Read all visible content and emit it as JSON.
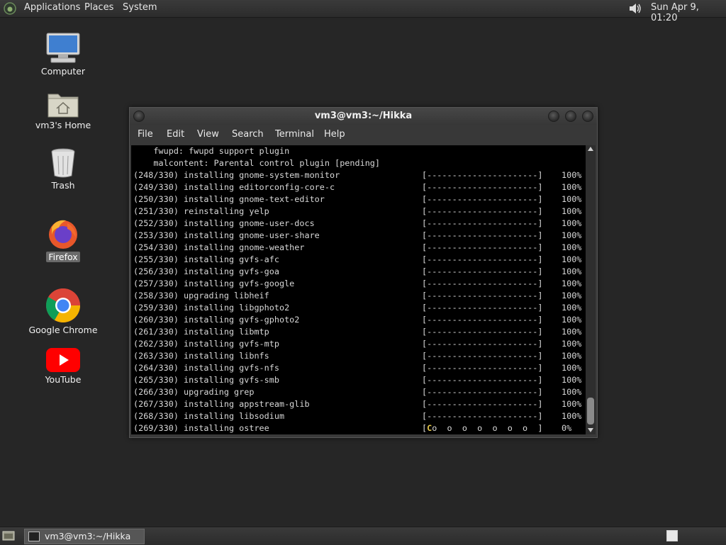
{
  "top_panel": {
    "menus": [
      "Applications",
      "Places",
      "System"
    ],
    "clock": "Sun Apr  9, 01:20",
    "icons": [
      "gnome-foot-icon",
      "volume-icon"
    ]
  },
  "desktop": {
    "icons": [
      {
        "label": "Computer",
        "icon": "computer-icon"
      },
      {
        "label": "vm3's Home",
        "icon": "home-folder-icon"
      },
      {
        "label": "Trash",
        "icon": "trash-icon"
      },
      {
        "label": "Firefox",
        "icon": "firefox-icon"
      },
      {
        "label": "Google Chrome",
        "icon": "chrome-icon"
      },
      {
        "label": "YouTube",
        "icon": "youtube-icon"
      }
    ]
  },
  "terminal": {
    "title": "vm3@vm3:~/Hikka",
    "menu": [
      "File",
      "Edit",
      "View",
      "Search",
      "Terminal",
      "Help"
    ],
    "header_lines": [
      "    fwupd: fwupd support plugin",
      "    malcontent: Parental control plugin [pending]"
    ],
    "progress_lines": [
      {
        "text": "(248/330) installing gnome-system-monitor",
        "bar": "[----------------------]",
        "pct": "100%"
      },
      {
        "text": "(249/330) installing editorconfig-core-c",
        "bar": "[----------------------]",
        "pct": "100%"
      },
      {
        "text": "(250/330) installing gnome-text-editor",
        "bar": "[----------------------]",
        "pct": "100%"
      },
      {
        "text": "(251/330) reinstalling yelp",
        "bar": "[----------------------]",
        "pct": "100%"
      },
      {
        "text": "(252/330) installing gnome-user-docs",
        "bar": "[----------------------]",
        "pct": "100%"
      },
      {
        "text": "(253/330) installing gnome-user-share",
        "bar": "[----------------------]",
        "pct": "100%"
      },
      {
        "text": "(254/330) installing gnome-weather",
        "bar": "[----------------------]",
        "pct": "100%"
      },
      {
        "text": "(255/330) installing gvfs-afc",
        "bar": "[----------------------]",
        "pct": "100%"
      },
      {
        "text": "(256/330) installing gvfs-goa",
        "bar": "[----------------------]",
        "pct": "100%"
      },
      {
        "text": "(257/330) installing gvfs-google",
        "bar": "[----------------------]",
        "pct": "100%"
      },
      {
        "text": "(258/330) upgrading libheif",
        "bar": "[----------------------]",
        "pct": "100%"
      },
      {
        "text": "(259/330) installing libgphoto2",
        "bar": "[----------------------]",
        "pct": "100%"
      },
      {
        "text": "(260/330) installing gvfs-gphoto2",
        "bar": "[----------------------]",
        "pct": "100%"
      },
      {
        "text": "(261/330) installing libmtp",
        "bar": "[----------------------]",
        "pct": "100%"
      },
      {
        "text": "(262/330) installing gvfs-mtp",
        "bar": "[----------------------]",
        "pct": "100%"
      },
      {
        "text": "(263/330) installing libnfs",
        "bar": "[----------------------]",
        "pct": "100%"
      },
      {
        "text": "(264/330) installing gvfs-nfs",
        "bar": "[----------------------]",
        "pct": "100%"
      },
      {
        "text": "(265/330) installing gvfs-smb",
        "bar": "[----------------------]",
        "pct": "100%"
      },
      {
        "text": "(266/330) upgrading grep",
        "bar": "[----------------------]",
        "pct": "100%"
      },
      {
        "text": "(267/330) installing appstream-glib",
        "bar": "[----------------------]",
        "pct": "100%"
      },
      {
        "text": "(268/330) installing libsodium",
        "bar": "[----------------------]",
        "pct": "100%"
      },
      {
        "text": "(269/330) installing ostree",
        "bar_pacman": "C",
        "bar_rest": "o  o  o  o  o  o  o  ]",
        "pct": "0%"
      }
    ]
  },
  "taskbar": {
    "window_label": "vm3@vm3:~/Hikka"
  }
}
